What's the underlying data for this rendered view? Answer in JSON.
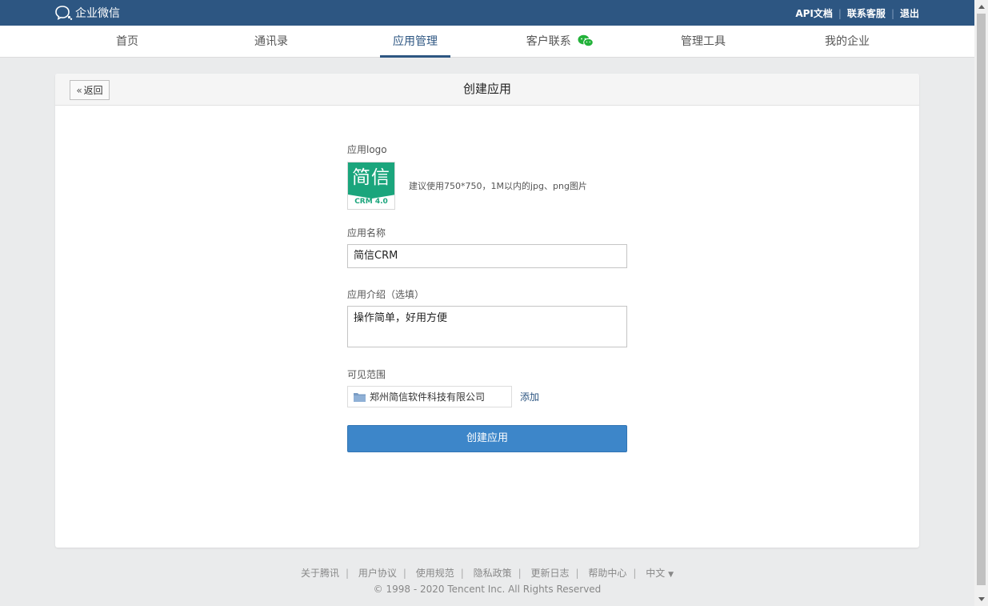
{
  "topbar": {
    "brand": "企业微信",
    "links": [
      "API文档",
      "联系客服",
      "退出"
    ]
  },
  "nav": {
    "items": [
      "首页",
      "通讯录",
      "应用管理",
      "客户联系",
      "管理工具",
      "我的企业"
    ],
    "active": "应用管理"
  },
  "card": {
    "back_label": "返回",
    "title": "创建应用"
  },
  "form": {
    "logo_label": "应用logo",
    "logo_text_top": "简信",
    "logo_text_bottom": "CRM 4.0",
    "logo_hint": "建议使用750*750，1M以内的jpg、png图片",
    "name_label": "应用名称",
    "name_value": "简信CRM",
    "intro_label": "应用介绍（选填）",
    "intro_value": "操作简单，好用方便",
    "scope_label": "可见范围",
    "scope_value": "郑州简信软件科技有限公司",
    "add_label": "添加",
    "submit_label": "创建应用"
  },
  "footer": {
    "links": [
      "关于腾讯",
      "用户协议",
      "使用规范",
      "隐私政策",
      "更新日志",
      "帮助中心",
      "中文"
    ],
    "lang_caret": "▼",
    "copyright": "© 1998 - 2020 Tencent Inc. All Rights Reserved"
  },
  "colors": {
    "topbar": "#2d5682",
    "accent": "#2d5682",
    "primary_button": "#3d86c9",
    "logo_green": "#1aa57c"
  }
}
